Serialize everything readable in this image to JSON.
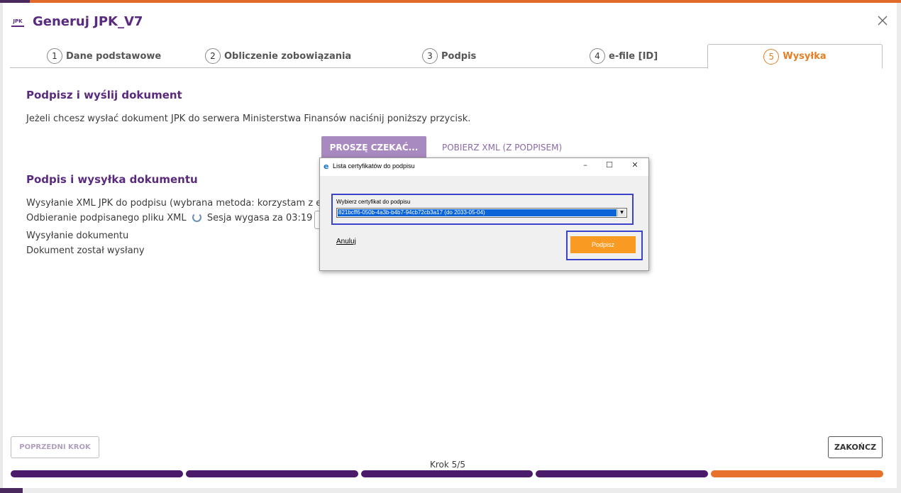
{
  "header": {
    "title": "Generuj JPK_V7",
    "icon": "JPK"
  },
  "tabs": [
    {
      "num": "1",
      "label": "Dane podstawowe"
    },
    {
      "num": "2",
      "label": "Obliczenie zobowiązania"
    },
    {
      "num": "3",
      "label": "Podpis"
    },
    {
      "num": "4",
      "label": "e-file [ID]"
    },
    {
      "num": "5",
      "label": "Wysyłka"
    }
  ],
  "sign_section": {
    "title": "Podpisz i wyślij dokument",
    "description": "Jeżeli chcesz wysłać dokument JPK do serwera Ministerstwa Finansów naciśnij poniższy przycisk.",
    "wait_button": "PROSZĘ CZEKAĆ...",
    "xml_button": "POBIERZ XML (Z PODPISEM)"
  },
  "status_section": {
    "title": "Podpis i wysyłka dokumentu",
    "line1": "Wysyłanie XML JPK do podpisu (wybrana metoda: korzystam z e-p",
    "line2_a": "Odbieranie podpisanego pliku XML",
    "line2_b": "Sesja wygasa za 03:19",
    "line3": "Wysyłanie dokumentu",
    "line4": "Dokument został wysłany"
  },
  "dialog": {
    "icon": "e",
    "title": "Lista certyfikatów do podpisu",
    "minimize": "–",
    "maximize": "☐",
    "close": "✕",
    "cert_label": "Wybierz certyfikat do podpisu",
    "cert_value": "821bcff6-050b-4a3b-b4b7-94cb72cb3a17 (do 2033-05-04)",
    "cancel": "Anuluj",
    "sign": "Podpisz"
  },
  "footer": {
    "prev": "POPRZEDNI KROK",
    "finish": "ZAKOŃCZ",
    "step": "Krok 5/5",
    "progress_current_step": 5,
    "progress_total_steps": 5
  },
  "colors": {
    "brand_purple": "#5a2a7e",
    "accent_orange": "#e8712e",
    "progress_done": "#4b1a6b",
    "dialog_highlight": "#3a43c9"
  }
}
